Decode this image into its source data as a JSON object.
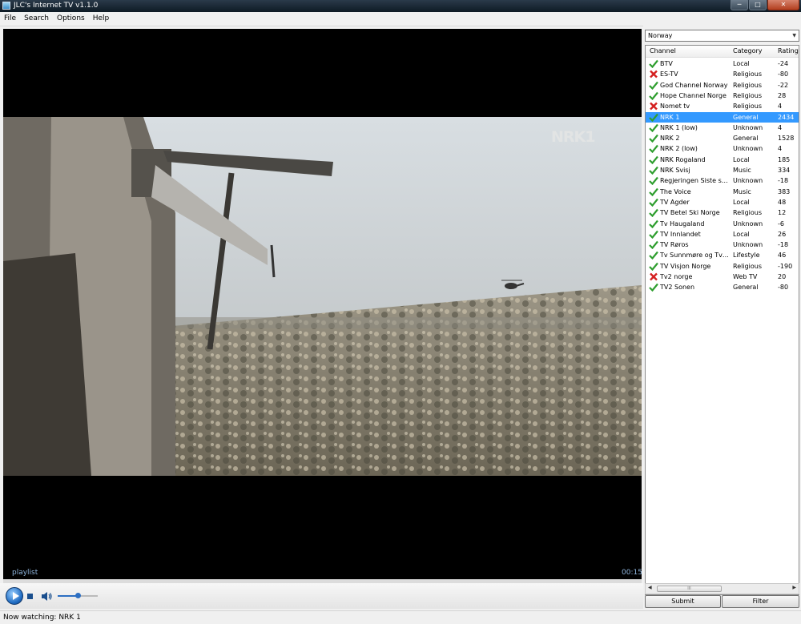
{
  "window": {
    "title": "JLC's Internet TV v1.1.0"
  },
  "menu": [
    "File",
    "Search",
    "Options",
    "Help"
  ],
  "player": {
    "watermark": "NRK1",
    "playlist_label": "playlist",
    "time": "00:15",
    "volume_fraction": 0.5
  },
  "country_select": {
    "value": "Norway"
  },
  "channel_list": {
    "headers": [
      "Channel",
      "Category",
      "Rating"
    ],
    "selected_index": 5,
    "rows": [
      {
        "status": "ok",
        "channel": "BTV",
        "category": "Local",
        "rating": "-24"
      },
      {
        "status": "bad",
        "channel": "ES-TV",
        "category": "Religious",
        "rating": "-80"
      },
      {
        "status": "ok",
        "channel": "God Channel Norway",
        "category": "Religious",
        "rating": "-22"
      },
      {
        "status": "ok",
        "channel": "Hope Channel Norge",
        "category": "Religious",
        "rating": "28"
      },
      {
        "status": "bad",
        "channel": "Nomet tv",
        "category": "Religious",
        "rating": "4"
      },
      {
        "status": "ok",
        "channel": "NRK 1",
        "category": "General",
        "rating": "2434"
      },
      {
        "status": "ok",
        "channel": "NRK 1 (low)",
        "category": "Unknown",
        "rating": "4"
      },
      {
        "status": "ok",
        "channel": "NRK 2",
        "category": "General",
        "rating": "1528"
      },
      {
        "status": "ok",
        "channel": "NRK 2 (low)",
        "category": "Unknown",
        "rating": "4"
      },
      {
        "status": "ok",
        "channel": "NRK Rogaland",
        "category": "Local",
        "rating": "185"
      },
      {
        "status": "ok",
        "channel": "NRK Svisj",
        "category": "Music",
        "rating": "334"
      },
      {
        "status": "ok",
        "channel": "Regjeringen Siste se...",
        "category": "Unknown",
        "rating": "-18"
      },
      {
        "status": "ok",
        "channel": "The Voice",
        "category": "Music",
        "rating": "383"
      },
      {
        "status": "ok",
        "channel": "TV Agder",
        "category": "Local",
        "rating": "48"
      },
      {
        "status": "ok",
        "channel": "TV Betel Ski Norge",
        "category": "Religious",
        "rating": "12"
      },
      {
        "status": "ok",
        "channel": "Tv Haugaland",
        "category": "Unknown",
        "rating": "-6"
      },
      {
        "status": "ok",
        "channel": "TV Innlandet",
        "category": "Local",
        "rating": "26"
      },
      {
        "status": "ok",
        "channel": "TV Røros",
        "category": "Unknown",
        "rating": "-18"
      },
      {
        "status": "ok",
        "channel": "Tv Sunnmøre og Tv ...",
        "category": "Lifestyle",
        "rating": "46"
      },
      {
        "status": "ok",
        "channel": "TV Visjon Norge",
        "category": "Religious",
        "rating": "-190"
      },
      {
        "status": "bad",
        "channel": "Tv2 norge",
        "category": "Web TV",
        "rating": "20"
      },
      {
        "status": "ok",
        "channel": "TV2 Sonen",
        "category": "General",
        "rating": "-80"
      }
    ]
  },
  "buttons": {
    "submit": "Submit",
    "filter": "Filter"
  },
  "scrollbar_grip": "III",
  "status": {
    "text": "Now watching: NRK 1"
  },
  "colors": {
    "ok": "#2e9e2e",
    "bad": "#d42020",
    "selected": "#3399ff"
  }
}
